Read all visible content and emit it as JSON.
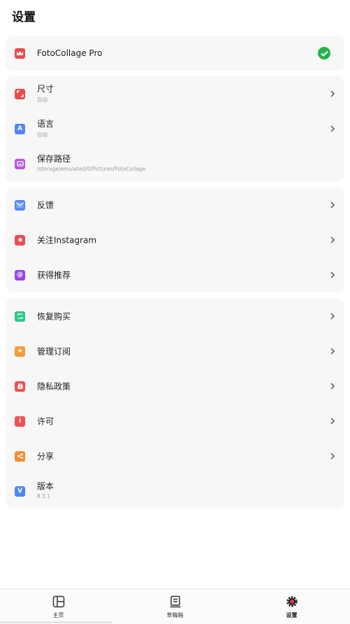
{
  "header": {
    "title": "设置"
  },
  "pro": {
    "label": "FotoCollage Pro",
    "icon": "crown-icon",
    "status_icon": "check-circle-icon"
  },
  "group1": [
    {
      "title": "尺寸",
      "subtitle": "自动",
      "icon": "resize-icon"
    },
    {
      "title": "语言",
      "subtitle": "自动",
      "icon": "language-icon"
    },
    {
      "title": "保存路径",
      "subtitle": "/storage/emulated/0/Pictures/FotoCollage",
      "icon": "folder-icon"
    }
  ],
  "group2": [
    {
      "title": "反馈",
      "icon": "mail-icon"
    },
    {
      "title": "关注Instagram",
      "icon": "instagram-icon"
    },
    {
      "title": "获得推荐",
      "icon": "recommend-icon"
    }
  ],
  "group3": [
    {
      "title": "恢复购买",
      "icon": "restore-icon"
    },
    {
      "title": "管理订阅",
      "icon": "subscription-icon"
    },
    {
      "title": "隐私政策",
      "icon": "privacy-icon"
    },
    {
      "title": "许可",
      "icon": "license-icon"
    },
    {
      "title": "分享",
      "icon": "share-icon"
    },
    {
      "title": "版本",
      "subtitle": "8.3.1",
      "icon": "version-icon"
    }
  ],
  "tabs": [
    {
      "label": "主页",
      "icon": "home-collage-icon"
    },
    {
      "label": "草稿箱",
      "icon": "drafts-icon"
    },
    {
      "label": "设置",
      "icon": "settings-gear-icon",
      "active": true
    }
  ],
  "colors": {
    "card_bg": "#f7f7f7",
    "check_green": "#22b34a",
    "crown_red": "#ea4b4b",
    "language_blue": "#4f86f7",
    "folder_purple": "#b757e6",
    "instagram_red": "#ee4b55",
    "recommend_purple": "#9b46e0",
    "restore_green": "#2fc88a",
    "subscription_orange": "#f59a3a",
    "privacy_red": "#ef5050",
    "share_orange": "#f58b34",
    "version_blue": "#4d86f7"
  }
}
